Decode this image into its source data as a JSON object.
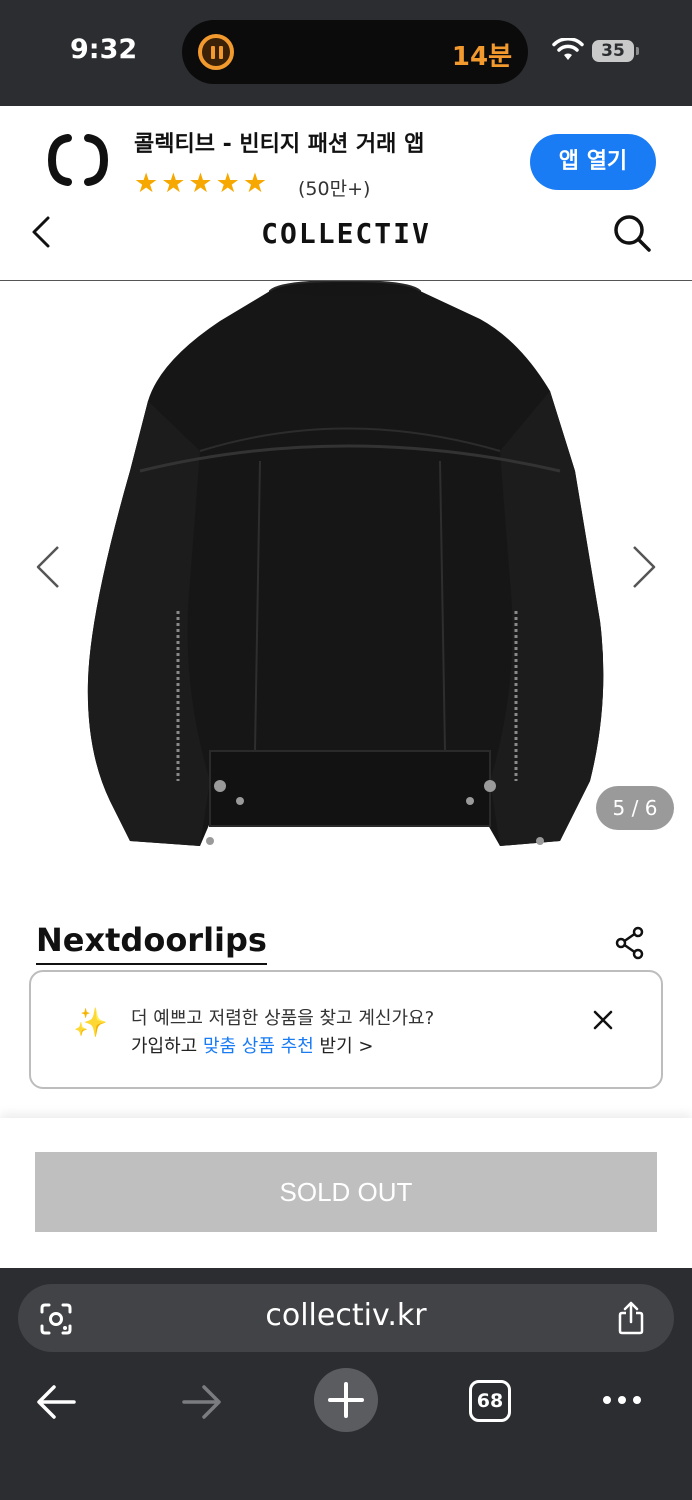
{
  "status_bar": {
    "time": "9:32",
    "activity_timer": "14분",
    "battery": "35",
    "accent_color": "#f29a2e"
  },
  "app_banner": {
    "title": "콜렉티브 - 빈티지 패션 거래 앱",
    "stars": "★★★★★",
    "rating": 4.5,
    "rating_count": "(50만+)",
    "open_button": "앱 열기",
    "button_color": "#1a7cf5"
  },
  "header": {
    "brand": "COLLECTIV",
    "back_icon": "chevron-left-icon",
    "search_icon": "search-icon"
  },
  "gallery": {
    "counter": "5 / 6",
    "current_index": 5,
    "total": 6,
    "prev_icon": "chevron-left-icon",
    "next_icon": "chevron-right-icon"
  },
  "product": {
    "seller": "Nextdoorlips",
    "share_icon": "share-icon"
  },
  "promo": {
    "line1": "더 예쁘고 저렴한 상품을 찾고 계신가요?",
    "line2_prefix": "가입하고 ",
    "line2_highlight": "맞춤 상품 추천",
    "line2_suffix": " 받기 >",
    "highlight_color": "#1a7cf5"
  },
  "bottom_bar": {
    "sold_out_label": "SOLD OUT"
  },
  "browser": {
    "url": "collectiv.kr",
    "tab_count": "68"
  }
}
